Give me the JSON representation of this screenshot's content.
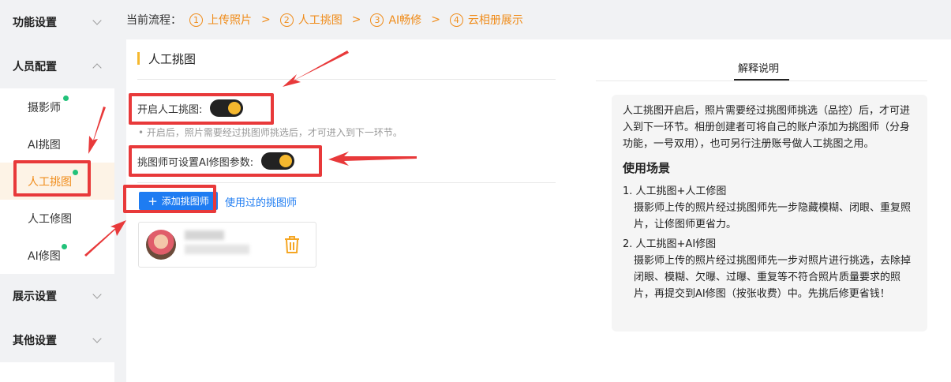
{
  "sidebar": {
    "groups": [
      {
        "label": "功能设置",
        "expanded": false
      },
      {
        "label": "人员配置",
        "expanded": true
      },
      {
        "label": "展示设置",
        "expanded": false
      },
      {
        "label": "其他设置",
        "expanded": false
      }
    ],
    "sub_items": [
      {
        "label": "摄影师",
        "dot": true
      },
      {
        "label": "AI挑图",
        "dot": false
      },
      {
        "label": "人工挑图",
        "dot": true,
        "active": true
      },
      {
        "label": "人工修图",
        "dot": false
      },
      {
        "label": "AI修图",
        "dot": true
      }
    ]
  },
  "process": {
    "label": "当前流程：",
    "steps": [
      {
        "num": "1",
        "label": "上传照片"
      },
      {
        "num": "2",
        "label": "人工挑图"
      },
      {
        "num": "3",
        "label": "AI畅修"
      },
      {
        "num": "4",
        "label": "云相册展示"
      }
    ],
    "separator": ">"
  },
  "main": {
    "title": "人工挑图",
    "toggle1_label": "开启人工挑图:",
    "toggle1_on": true,
    "hint": "• 开启后，照片需要经过挑图师挑选后，才可进入到下一环节。",
    "toggle2_label": "挑图师可设置AI修图参数:",
    "toggle2_on": true,
    "add_button": "添加挑图师",
    "add_plus": "+",
    "used_link": "使用过的挑图师"
  },
  "explain": {
    "tab": "解释说明",
    "intro": "人工挑图开启后，照片需要经过挑图师挑选（品控）后，才可进入到下一环节。相册创建者可将自己的账户添加为挑图师（分身功能，一号双用），也可另行注册账号做人工挑图之用。",
    "scene_title": "使用场景",
    "scenes": [
      {
        "title": "1. 人工挑图+人工修图",
        "body": "摄影师上传的照片经过挑图师先一步隐藏模糊、闭眼、重复照片，让修图师更省力。"
      },
      {
        "title": "2. 人工挑图+AI修图",
        "body": "摄影师上传的照片经过挑图师先一步对照片进行挑选，去除掉闭眼、模糊、欠曝、过曝、重复等不符合照片质量要求的照片，再提交到AI修图（按张收费）中。先挑后修更省钱！"
      }
    ]
  },
  "colors": {
    "accent": "#f08c1a",
    "toggle_knob": "#f5b82e",
    "primary": "#1e7cf2",
    "annotation": "#e8393a",
    "dot": "#22c27a"
  }
}
